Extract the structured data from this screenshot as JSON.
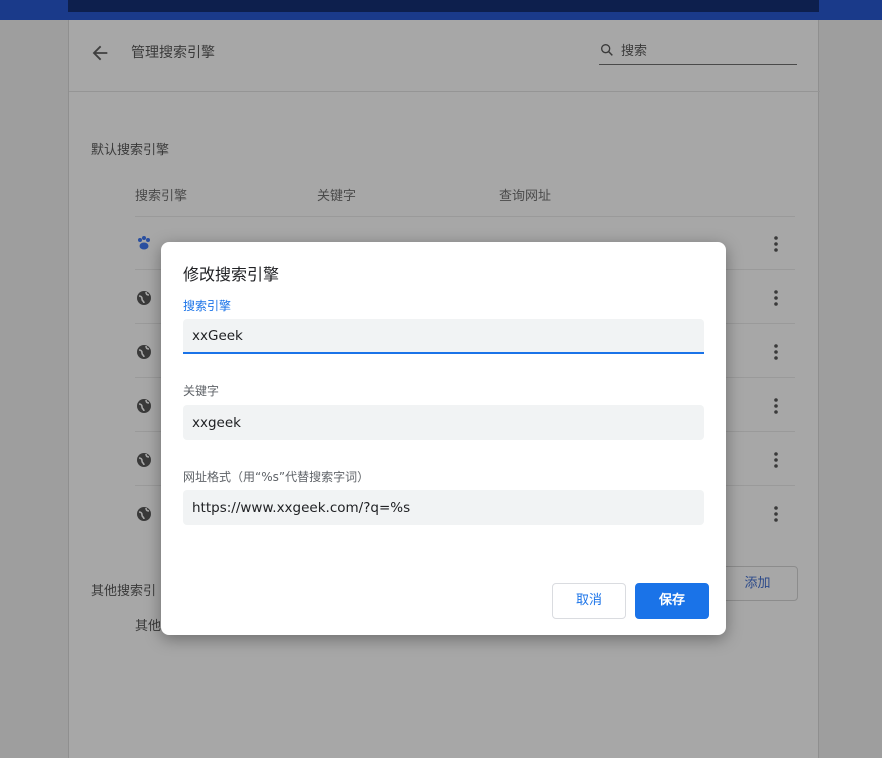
{
  "header": {
    "title": "管理搜索引擎",
    "search_placeholder": "搜索"
  },
  "default_section": {
    "label": "默认搜索引擎",
    "columns": [
      "搜索引擎",
      "关键字",
      "查询网址"
    ],
    "rows": [
      {
        "icon": "baidu-paw-icon"
      },
      {
        "icon": "globe-icon"
      },
      {
        "icon": "globe-icon"
      },
      {
        "icon": "globe-icon"
      },
      {
        "icon": "globe-icon"
      },
      {
        "icon": "globe-icon"
      }
    ]
  },
  "other_section": {
    "label": "其他搜索引",
    "sub_label": "其他",
    "add_label": "添加"
  },
  "dialog": {
    "title": "修改搜索引擎",
    "engine_label": "搜索引擎",
    "engine_value": "xxGeek",
    "keyword_label": "关键字",
    "keyword_value": "xxgeek",
    "url_label": "网址格式（用“%s”代替搜索字词）",
    "url_value": "https://www.xxgeek.com/?q=%s",
    "cancel_label": "取消",
    "save_label": "保存"
  },
  "colors": {
    "accent": "#1a73e8",
    "overlay": "#9e9e9e"
  }
}
